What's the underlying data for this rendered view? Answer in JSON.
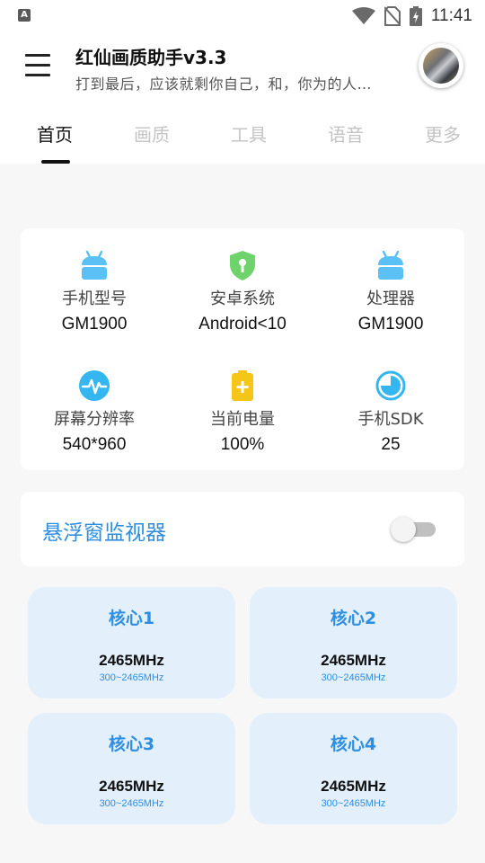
{
  "status_bar": {
    "time": "11:41",
    "notification_icon": "A"
  },
  "app_bar": {
    "title": "红仙画质助手v3.3",
    "subtitle": "打到最后，应该就剩你自己，和，你为的人…"
  },
  "tabs": [
    {
      "label": "首页",
      "active": true
    },
    {
      "label": "画质",
      "active": false
    },
    {
      "label": "工具",
      "active": false
    },
    {
      "label": "语音",
      "active": false
    },
    {
      "label": "更多",
      "active": false
    }
  ],
  "device_info": [
    {
      "icon": "android-icon",
      "label": "手机型号",
      "value": "GM1900"
    },
    {
      "icon": "shield-key-icon",
      "label": "安卓系统",
      "value": "Android<10"
    },
    {
      "icon": "android-icon",
      "label": "处理器",
      "value": "GM1900"
    },
    {
      "icon": "pulse-icon",
      "label": "屏幕分辨率",
      "value": "540*960"
    },
    {
      "icon": "battery-icon",
      "label": "当前电量",
      "value": "100%"
    },
    {
      "icon": "pie-icon",
      "label": "手机SDK",
      "value": "25"
    }
  ],
  "floating_monitor": {
    "label": "悬浮窗监视器",
    "enabled": false
  },
  "cores": [
    {
      "name": "核心1",
      "frequency": "2465MHz",
      "range": "300~2465MHz"
    },
    {
      "name": "核心2",
      "frequency": "2465MHz",
      "range": "300~2465MHz"
    },
    {
      "name": "核心3",
      "frequency": "2465MHz",
      "range": "300~2465MHz"
    },
    {
      "name": "核心4",
      "frequency": "2465MHz",
      "range": "300~2465MHz"
    }
  ],
  "colors": {
    "accent": "#2e8ee0",
    "android_blue": "#5bc0f5",
    "shield_green": "#6fd36b",
    "battery_yellow": "#f5c518",
    "core_bg": "#e3f0fb"
  }
}
